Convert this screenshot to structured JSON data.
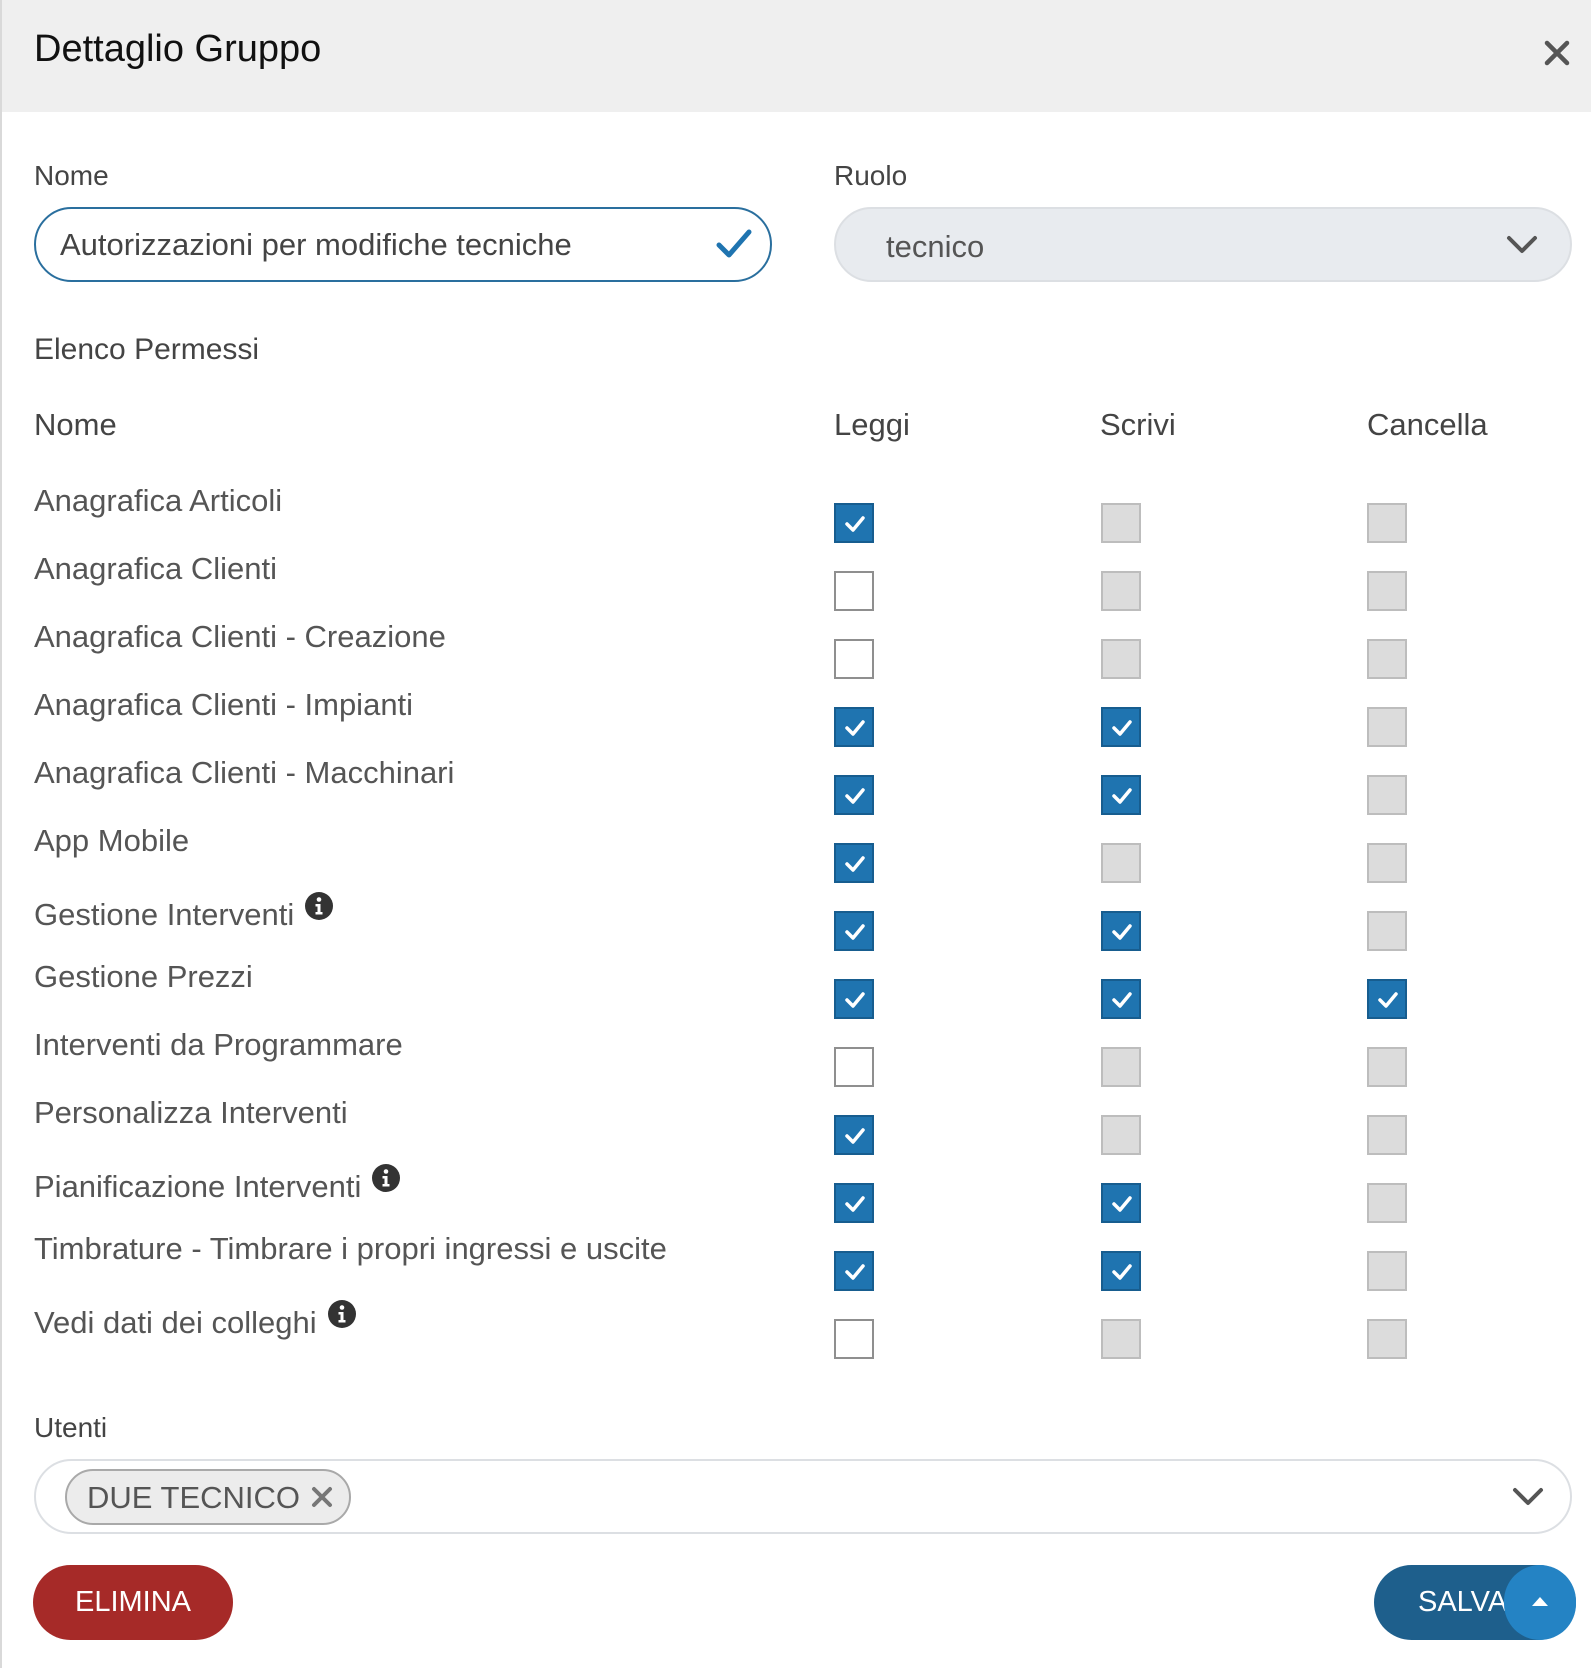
{
  "dialog": {
    "title": "Dettaglio Gruppo"
  },
  "form": {
    "name_label": "Nome",
    "name_value": "Autorizzazioni per modifiche tecniche",
    "role_label": "Ruolo",
    "role_value": "tecnico"
  },
  "permissions": {
    "title": "Elenco Permessi",
    "headers": {
      "name": "Nome",
      "read": "Leggi",
      "write": "Scrivi",
      "delete": "Cancella"
    },
    "rows": [
      {
        "name": "Anagrafica Articoli",
        "info": false,
        "read": "checked",
        "write": "disabled",
        "delete": "disabled"
      },
      {
        "name": "Anagrafica Clienti",
        "info": false,
        "read": "unchecked",
        "write": "disabled",
        "delete": "disabled"
      },
      {
        "name": "Anagrafica Clienti - Creazione",
        "info": false,
        "read": "unchecked",
        "write": "disabled",
        "delete": "disabled"
      },
      {
        "name": "Anagrafica Clienti - Impianti",
        "info": false,
        "read": "checked",
        "write": "checked",
        "delete": "disabled"
      },
      {
        "name": "Anagrafica Clienti - Macchinari",
        "info": false,
        "read": "checked",
        "write": "checked",
        "delete": "disabled"
      },
      {
        "name": "App Mobile",
        "info": false,
        "read": "checked",
        "write": "disabled",
        "delete": "disabled"
      },
      {
        "name": "Gestione Interventi",
        "info": true,
        "read": "checked",
        "write": "checked",
        "delete": "disabled"
      },
      {
        "name": "Gestione Prezzi",
        "info": false,
        "read": "checked",
        "write": "checked",
        "delete": "checked"
      },
      {
        "name": "Interventi da Programmare",
        "info": false,
        "read": "unchecked",
        "write": "disabled",
        "delete": "disabled"
      },
      {
        "name": "Personalizza Interventi",
        "info": false,
        "read": "checked",
        "write": "disabled",
        "delete": "disabled"
      },
      {
        "name": "Pianificazione Interventi",
        "info": true,
        "read": "checked",
        "write": "checked",
        "delete": "disabled"
      },
      {
        "name": "Timbrature - Timbrare i propri ingressi e uscite",
        "info": false,
        "read": "checked",
        "write": "checked",
        "delete": "disabled"
      },
      {
        "name": "Vedi dati dei colleghi",
        "info": true,
        "read": "unchecked",
        "write": "disabled",
        "delete": "disabled"
      }
    ]
  },
  "users": {
    "label": "Utenti",
    "chips": [
      {
        "label": "DUE TECNICO"
      }
    ]
  },
  "actions": {
    "delete_label": "ELIMINA",
    "save_label": "SALVA"
  },
  "colors": {
    "accent": "#1f74b0",
    "danger": "#a62a28",
    "header_bg": "#efefef"
  },
  "icons": {
    "close": "close-icon",
    "input_valid": "check-icon",
    "select": "chevron-down-icon",
    "info": "info-icon",
    "chip_remove": "close-icon",
    "scroll_top": "caret-up-icon"
  }
}
